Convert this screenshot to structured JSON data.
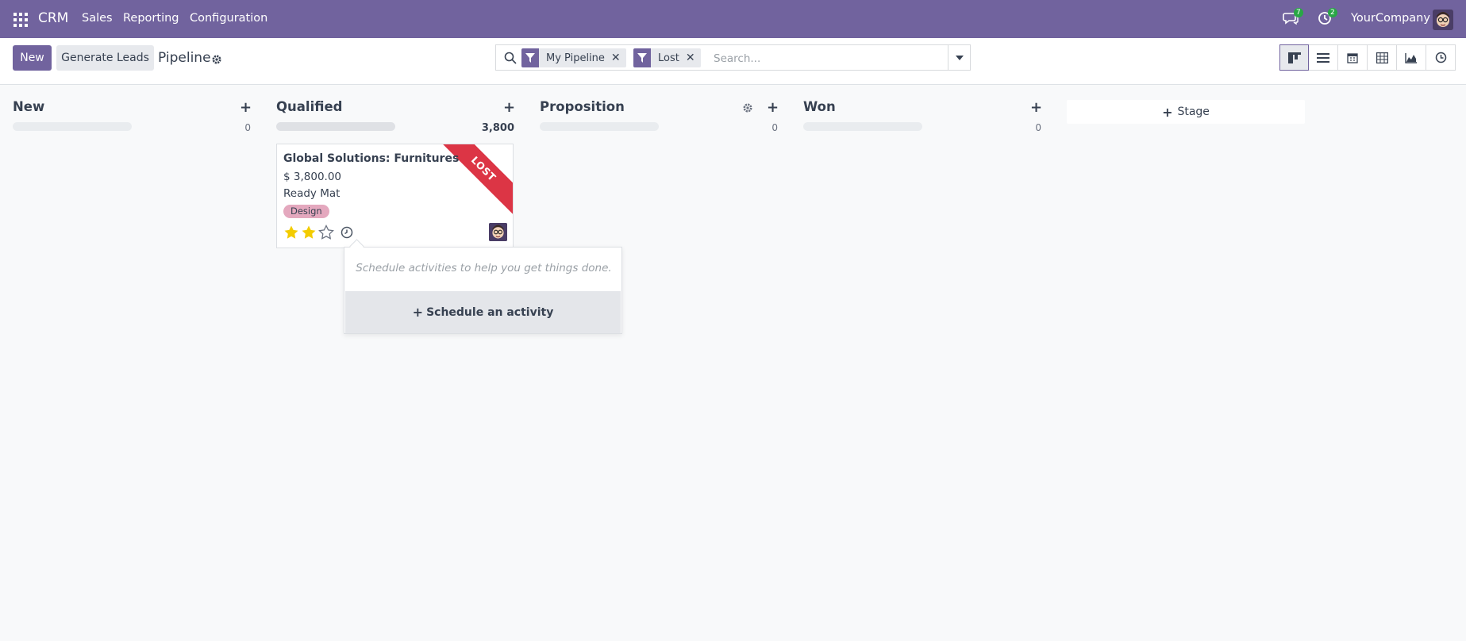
{
  "navbar": {
    "app_name": "CRM",
    "menu": [
      "Sales",
      "Reporting",
      "Configuration"
    ],
    "messages_badge": "7",
    "activities_badge": "2",
    "company": "YourCompany"
  },
  "control": {
    "new_label": "New",
    "generate_label": "Generate Leads",
    "page_title": "Pipeline",
    "facets": [
      "My Pipeline",
      "Lost"
    ],
    "search_placeholder": "Search..."
  },
  "columns": [
    {
      "title": "New",
      "count": "0"
    },
    {
      "title": "Qualified",
      "count": "3,800"
    },
    {
      "title": "Proposition",
      "count": "0"
    },
    {
      "title": "Won",
      "count": "0"
    }
  ],
  "add_stage_label": "Stage",
  "card": {
    "title": "Global Solutions: Furnitures",
    "amount": "$ 3,800.00",
    "company": "Ready Mat",
    "tag": "Design",
    "ribbon": "LOST",
    "rating": 2,
    "rating_max": 3
  },
  "popover": {
    "hint": "Schedule activities to help you get things done.",
    "button_label": "Schedule an activity"
  },
  "colors": {
    "brand": "#71639e",
    "ribbon": "#dc3545",
    "star": "#f3cc00",
    "tag": "#e4a8be",
    "badge": "#28a745"
  }
}
